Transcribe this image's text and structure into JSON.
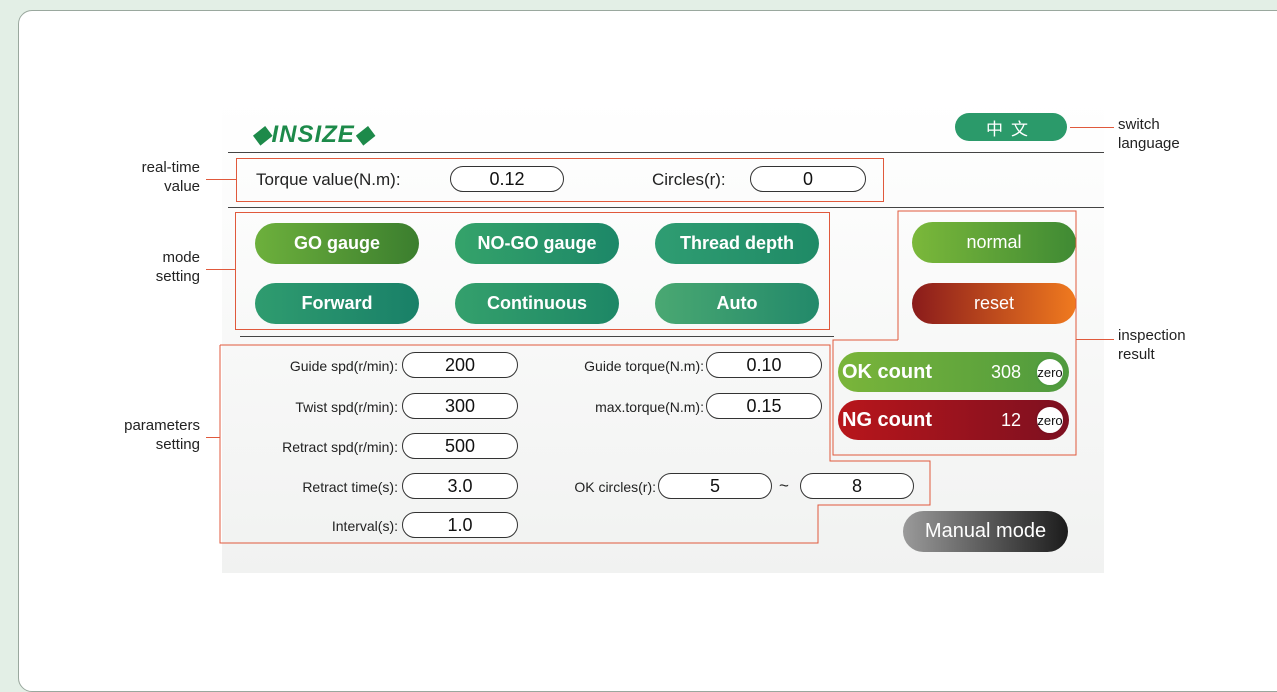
{
  "brand": "INSIZE",
  "language_button": "中文",
  "realtime": {
    "torque_label": "Torque value(N.m):",
    "torque_value": "0.12",
    "circles_label": "Circles(r):",
    "circles_value": "0"
  },
  "modes": {
    "row1": [
      "GO gauge",
      "NO-GO gauge",
      "Thread depth"
    ],
    "row2": [
      "Forward",
      "Continuous",
      "Auto"
    ]
  },
  "status": {
    "normal": "normal",
    "reset": "reset"
  },
  "counts": {
    "ok_label": "OK count",
    "ok_value": "308",
    "ng_label": "NG count",
    "ng_value": "12",
    "zero_label": "zero"
  },
  "params": {
    "guide_spd_label": "Guide spd(r/min):",
    "guide_spd_value": "200",
    "twist_spd_label": "Twist spd(r/min):",
    "twist_spd_value": "300",
    "retract_spd_label": "Retract spd(r/min):",
    "retract_spd_value": "500",
    "retract_time_label": "Retract time(s):",
    "retract_time_value": "3.0",
    "interval_label": "Interval(s):",
    "interval_value": "1.0",
    "guide_torque_label": "Guide torque(N.m):",
    "guide_torque_value": "0.10",
    "max_torque_label": "max.torque(N.m):",
    "max_torque_value": "0.15",
    "ok_circles_label": "OK circles(r):",
    "ok_circles_min": "5",
    "tilde": "~",
    "ok_circles_max": "8"
  },
  "manual_mode": "Manual mode",
  "annotations": {
    "realtime_1": "real-time",
    "realtime_2": "value",
    "mode_1": "mode",
    "mode_2": "setting",
    "params_1": "parameters",
    "params_2": "setting",
    "switch_1": "switch",
    "switch_2": "language",
    "inspect_1": "inspection",
    "inspect_2": "result"
  },
  "colors": {
    "page_bg": "#e3efe6",
    "accent_green": "#2b9a6a",
    "annotation_red": "#e0593c",
    "ng_red": "#b8161b",
    "reset_orange": "#f07a1f"
  }
}
